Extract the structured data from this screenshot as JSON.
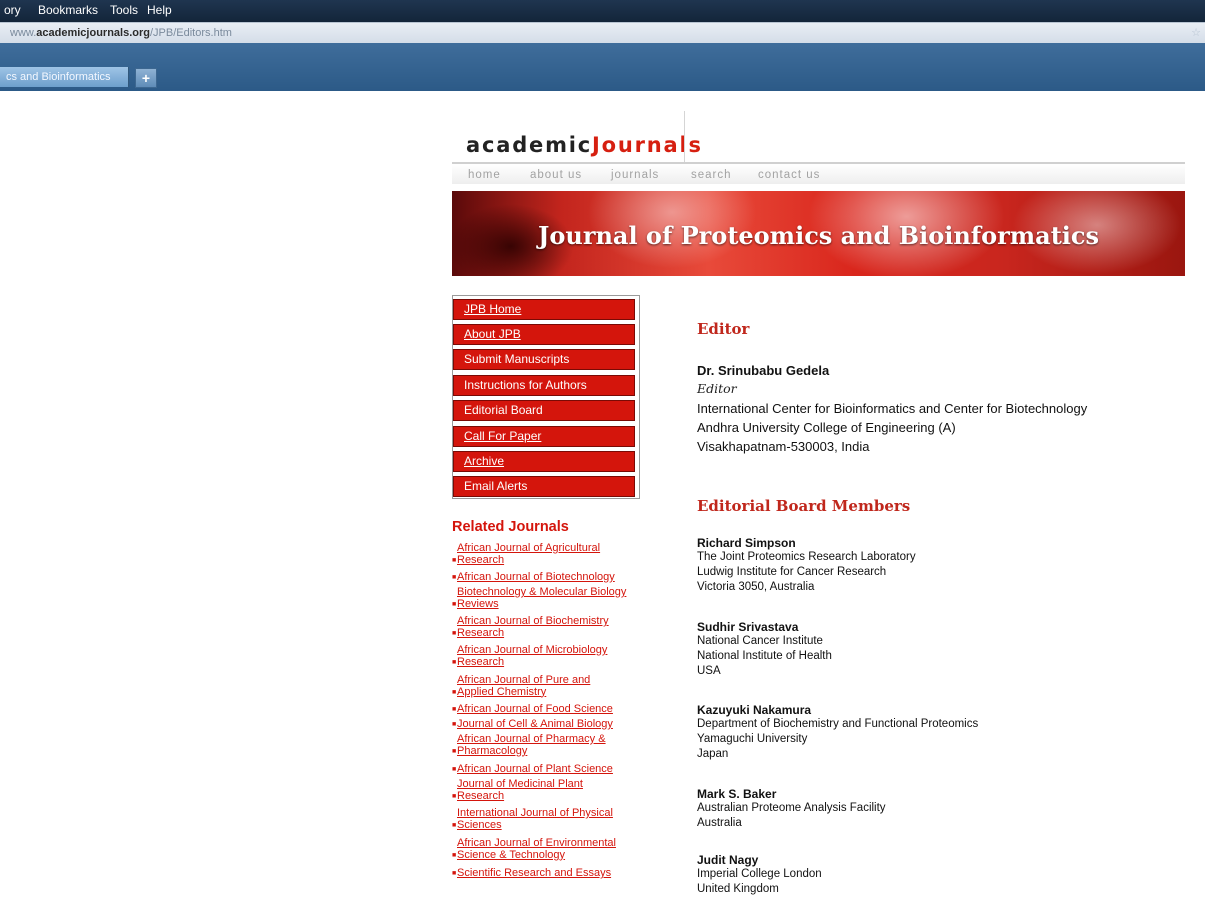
{
  "browser": {
    "menu": [
      "ory",
      "Bookmarks",
      "Tools",
      "Help"
    ],
    "url_domain_prefix": "www.",
    "url_domain": "academicjournals.org",
    "url_path": "/JPB/Editors.htm",
    "tab_label": "cs and Bioinformatics",
    "new_tab": "+"
  },
  "site": {
    "logo_left": "academic",
    "logo_right": "Journals",
    "nav": [
      "home",
      "about us",
      "journals",
      "search",
      "contact us"
    ],
    "banner_title": "Journal of Proteomics and Bioinformatics"
  },
  "menu": [
    "JPB Home",
    "About JPB",
    "Submit Manuscripts",
    "Instructions for Authors",
    "Editorial Board",
    "Call For Paper",
    "Archive",
    "Email Alerts"
  ],
  "related": {
    "title": "Related Journals",
    "items": [
      [
        "African Journal of Agricultural",
        "Research"
      ],
      [
        "African Journal  of Biotechnology"
      ],
      [
        "Biotechnology & Molecular Biology",
        "Reviews"
      ],
      [
        "African Journal of Biochemistry",
        "Research"
      ],
      [
        " African Journal of Microbiology",
        "Research"
      ],
      [
        "African Journal of Pure and",
        "Applied Chemistry"
      ],
      [
        "African Journal of Food Science"
      ],
      [
        "Journal of Cell & Animal Biology"
      ],
      [
        "African Journal of Pharmacy &",
        "Pharmacology"
      ],
      [
        "African Journal of Plant Science"
      ],
      [
        "Journal of Medicinal Plant",
        "Research"
      ],
      [
        "International Journal of Physical",
        "Sciences"
      ],
      [
        "African Journal of Environmental",
        "Science & Technology"
      ],
      [
        "Scientific Research and Essays"
      ]
    ]
  },
  "editor": {
    "heading": "Editor",
    "name": "Dr. Srinubabu Gedela",
    "role": "Editor",
    "lines": [
      "International Center for Bioinformatics and Center for Biotechnology",
      "Andhra University College of Engineering (A)",
      "Visakhapatnam-530003, India"
    ]
  },
  "board": {
    "heading": "Editorial Board Members",
    "members": [
      {
        "name": "Richard Simpson",
        "lines": [
          "The Joint Proteomics Research Laboratory",
          "Ludwig Institute for Cancer Research",
          "Victoria 3050, Australia"
        ]
      },
      {
        "name": "Sudhir Srivastava",
        "lines": [
          "National Cancer Institute",
          "National Institute of Health",
          "USA"
        ]
      },
      {
        "name": "Kazuyuki Nakamura",
        "lines": [
          "Department of Biochemistry and Functional Proteomics",
          "Yamaguchi University",
          "Japan"
        ]
      },
      {
        "name": "Mark S. Baker",
        "lines": [
          "Australian Proteome Analysis Facility",
          "Australia"
        ]
      },
      {
        "name": "Judit Nagy",
        "lines": [
          "Imperial College London",
          "United Kingdom"
        ]
      }
    ]
  },
  "colors": {
    "accent": "#d4150c",
    "heading": "#c0271c",
    "nav": "#a2a2a2"
  }
}
